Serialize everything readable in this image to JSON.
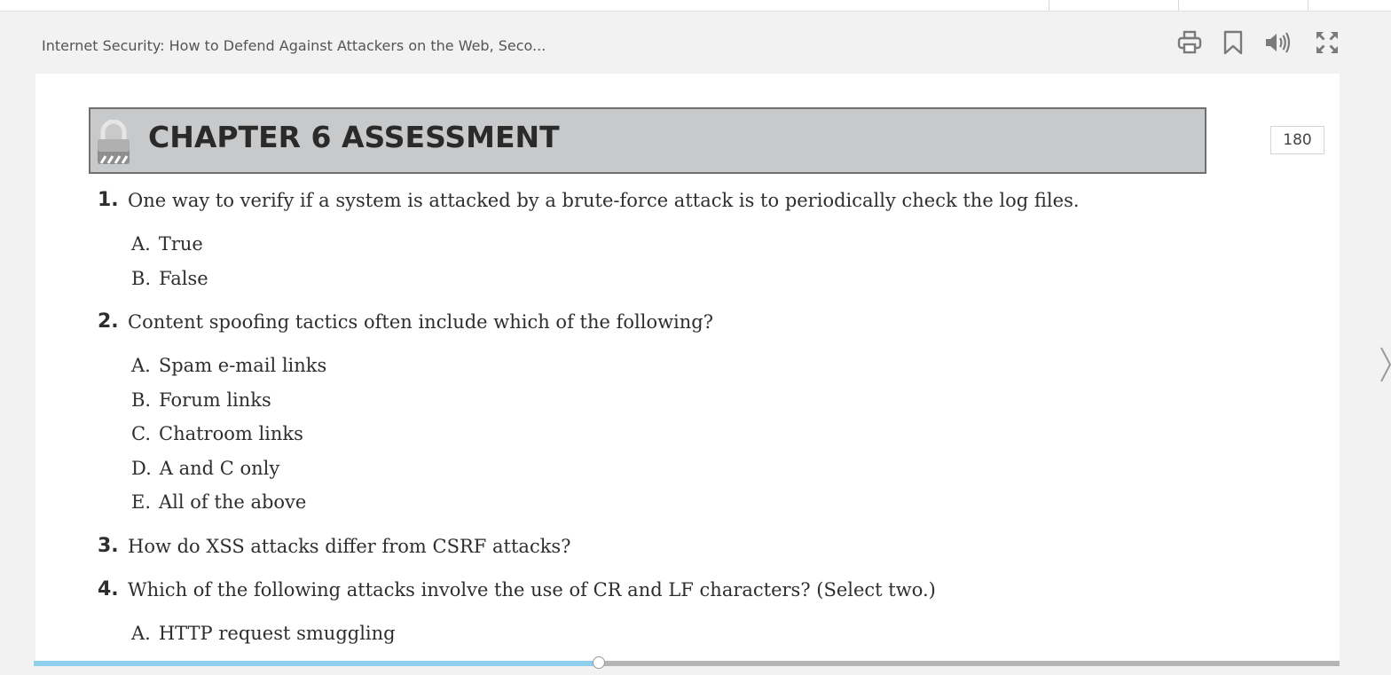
{
  "header": {
    "book_title": "Internet Security: How to Defend Against Attackers on the Web, Seco..."
  },
  "toolbar": {
    "print_icon": "print-icon",
    "bookmark_icon": "bookmark-icon",
    "audio_icon": "speaker-icon",
    "fullscreen_icon": "fullscreen-icon",
    "icon_color": "#7a7a7a"
  },
  "page": {
    "chapter_title": "CHAPTER 6 ASSESSMENT",
    "page_number": "180",
    "banner_color": "#c8c9cb",
    "questions": [
      {
        "number": "1.",
        "text": "One way to verify if a system is attacked by a brute-force attack is to periodically check the log files.",
        "options": [
          {
            "letter": "A.",
            "text": "True"
          },
          {
            "letter": "B.",
            "text": "False"
          }
        ]
      },
      {
        "number": "2.",
        "text": "Content spoofing tactics often include which of the following?",
        "options": [
          {
            "letter": "A.",
            "text": "Spam e-mail links"
          },
          {
            "letter": "B.",
            "text": "Forum links"
          },
          {
            "letter": "C.",
            "text": "Chatroom links"
          },
          {
            "letter": "D.",
            "text": "A and C only"
          },
          {
            "letter": "E.",
            "text": "All of the above"
          }
        ]
      },
      {
        "number": "3.",
        "text": "How do XSS attacks differ from CSRF attacks?",
        "options": []
      },
      {
        "number": "4.",
        "text": "Which of the following attacks involve the use of CR and LF characters? (Select two.)",
        "options": [
          {
            "letter": "A.",
            "text": "HTTP request smuggling"
          }
        ]
      }
    ]
  },
  "navigation": {
    "next_icon": "chevron-right-icon"
  },
  "reading_progress": {
    "fraction": 0.433,
    "fill_color": "#8fcfec",
    "track_color": "#b5b5b5"
  }
}
